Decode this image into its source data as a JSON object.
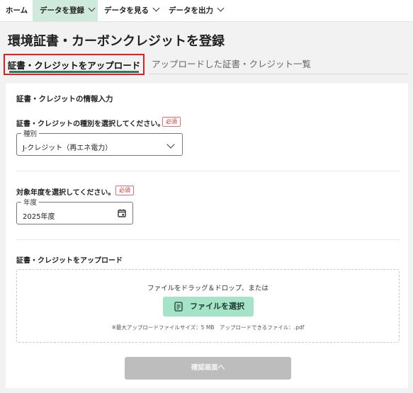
{
  "nav": {
    "items": [
      {
        "label": "ホーム",
        "dropdown": false
      },
      {
        "label": "データを登録",
        "dropdown": true,
        "active": true
      },
      {
        "label": "データを見る",
        "dropdown": true
      },
      {
        "label": "データを出力",
        "dropdown": true
      }
    ]
  },
  "page": {
    "title": "環境証書・カーボンクレジットを登録"
  },
  "tabs": [
    {
      "label": "証書・クレジットをアップロード",
      "active": true
    },
    {
      "label": "アップロードした証書・クレジット一覧",
      "active": false
    }
  ],
  "form": {
    "section_title": "証書・クレジットの情報入力",
    "type": {
      "prompt": "証書・クレジットの種別を選択してください。",
      "required": "必須",
      "legend": "種別",
      "value": "J-クレジット（再エネ電力）"
    },
    "year": {
      "prompt": "対象年度を選択してください。",
      "required": "必須",
      "legend": "年度",
      "value": "2025年度"
    },
    "upload": {
      "title": "証書・クレジットをアップロード",
      "drop_text": "ファイルをドラッグ＆ドロップ、または",
      "button": "ファイルを選択",
      "note": "※最大アップロードファイルサイズ：5 MB　アップロードできるファイル：.pdf"
    },
    "confirm_button": "確認画面へ"
  },
  "colors": {
    "accent_green": "#2a7a57",
    "file_button_bg": "#a6e4c9",
    "nav_active_bg": "#cfe9dc",
    "required_red": "#d03030",
    "highlight_border": "#e02020",
    "disabled_button": "#bdbdbd"
  }
}
